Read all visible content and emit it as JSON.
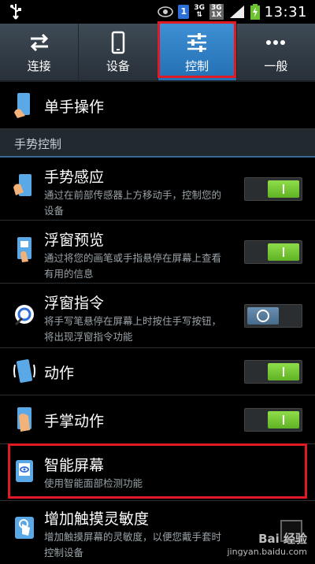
{
  "statusbar": {
    "time": "13:31",
    "sim": "1",
    "net1": "3G",
    "net2": "3G",
    "net2_sub": "1X"
  },
  "tabs": [
    {
      "label": "连接",
      "icon": "swap-arrows-icon",
      "active": false
    },
    {
      "label": "设备",
      "icon": "phone-icon",
      "active": false
    },
    {
      "label": "控制",
      "icon": "sliders-icon",
      "active": true
    },
    {
      "label": "一般",
      "icon": "more-dots-icon",
      "active": false
    }
  ],
  "rows": {
    "one_hand": {
      "title": "单手操作"
    },
    "section_gesture": "手势控制",
    "gesture_sense": {
      "title": "手势感应",
      "desc": "通过在前部传感器上方移动手，控制您的设备",
      "toggle": "on"
    },
    "air_view": {
      "title": "浮窗预览",
      "desc": "通过将您的画笔或手指悬停在屏幕上查看有用的信息",
      "toggle": "on"
    },
    "air_command": {
      "title": "浮窗指令",
      "desc": "将手写笔悬停在屏幕上时按住手写按钮，将出现浮窗指令功能",
      "toggle": "off"
    },
    "motion": {
      "title": "动作",
      "toggle": "on"
    },
    "palm_motion": {
      "title": "手掌动作",
      "toggle": "on"
    },
    "smart_screen": {
      "title": "智能屏幕",
      "desc": "使用智能面部检测功能"
    },
    "touch_sensitivity": {
      "title": "增加触摸灵敏度",
      "desc": "增加触摸屏幕的灵敏度，以便您戴手套时控制设备"
    }
  },
  "watermark": {
    "brand": "Bai 经验",
    "url": "jingyan.baidu.com"
  },
  "colors": {
    "accent": "#3e8fd4",
    "toggle_on": "#6cc230",
    "highlight": "#e01a22"
  }
}
